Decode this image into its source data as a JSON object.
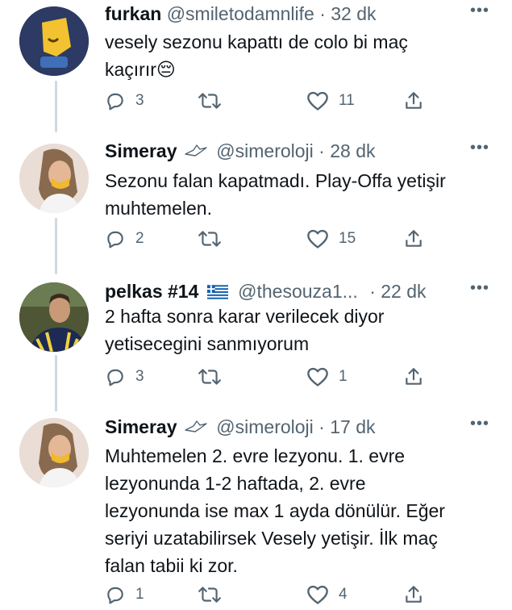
{
  "tweets": [
    {
      "name": "furkan",
      "handle": "@smiletodamnlife",
      "time": "· 32 dk",
      "text_lines": [
        "vesely sezonu kapattı de colo bi maç",
        "kaçırır😔"
      ],
      "replies": "3",
      "likes": "11",
      "avatar_color": "#2d3a63"
    },
    {
      "name": "Simeray",
      "handle": "@simeroloji",
      "time": "· 28 dk",
      "text_lines": [
        "Sezonu falan kapatmadı. Play-Offa yetişir",
        "muhtemelen."
      ],
      "replies": "2",
      "likes": "15",
      "avatar_color": "#e9ddd5"
    },
    {
      "name": "pelkas #14",
      "handle": "@thesouza1...",
      "time": "· 22 dk",
      "text_lines": [
        "2 hafta sonra karar verilecek diyor",
        "yetisecegini sanmıyorum"
      ],
      "replies": "3",
      "likes": "1",
      "avatar_color": "#3a3f2a"
    },
    {
      "name": "Simeray",
      "handle": "@simeroloji",
      "time": "· 17 dk",
      "text_lines": [
        "Muhtemelen 2. evre lezyonu. 1. evre",
        "lezyonunda 1-2 haftada, 2. evre",
        "lezyonunda ise max 1 ayda dönülür. Eğer",
        "seriyi uzatabilirsek Vesely yetişir. İlk maç",
        "falan tabii ki zor."
      ],
      "replies": "1",
      "likes": "4",
      "avatar_color": "#e9ddd5"
    }
  ],
  "more_label": "•••",
  "icons": [
    "reply-icon",
    "retweet-icon",
    "like-icon",
    "share-icon",
    "bird-icon",
    "greek-flag-icon"
  ]
}
